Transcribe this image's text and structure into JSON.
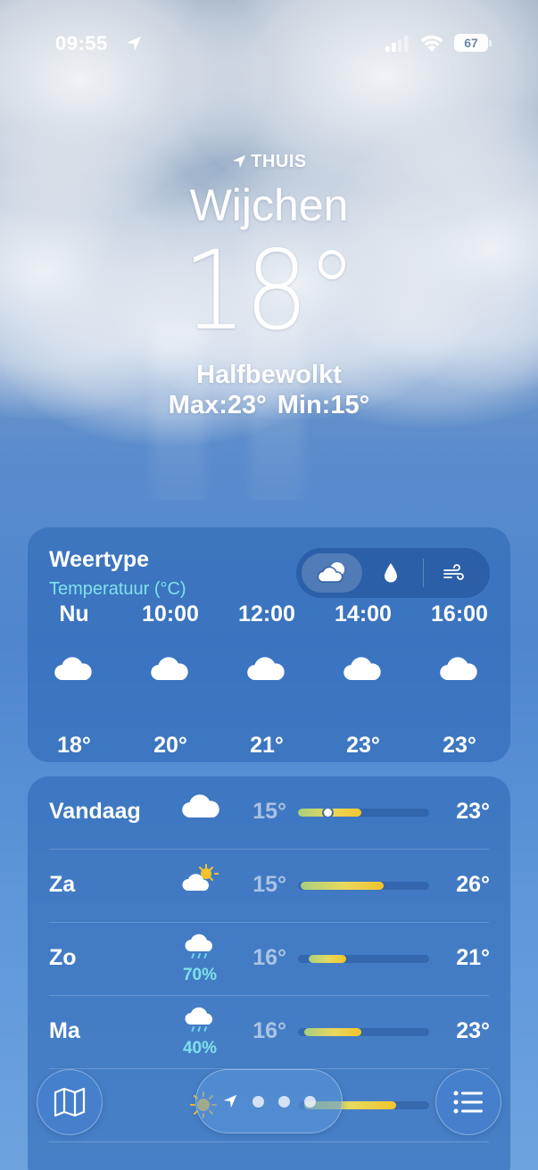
{
  "status_bar": {
    "time": "09:55",
    "battery": "67",
    "icons": [
      "location-arrow-icon",
      "cellular-signal-icon",
      "wifi-icon",
      "battery-icon"
    ]
  },
  "header": {
    "home_label": "THUIS",
    "city": "Wijchen",
    "temperature": "18°",
    "condition": "Halfbewolkt",
    "max": "Max:23°",
    "min": "Min:15°"
  },
  "hourly": {
    "title": "Weertype",
    "subtitle": "Temperatuur (°C)",
    "selected_tab": "cloud-sun-icon",
    "tabs": [
      "cloud-sun-icon",
      "precipitation-drop-icon",
      "wind-icon"
    ],
    "hours": [
      {
        "label": "Nu",
        "temp": "18°",
        "icon": "cloud-icon"
      },
      {
        "label": "10:00",
        "temp": "20°",
        "icon": "cloud-icon"
      },
      {
        "label": "12:00",
        "temp": "21°",
        "icon": "cloud-icon"
      },
      {
        "label": "14:00",
        "temp": "23°",
        "icon": "cloud-icon"
      },
      {
        "label": "16:00",
        "temp": "23°",
        "icon": "cloud-icon"
      }
    ]
  },
  "daily": {
    "days": [
      {
        "name": "Vandaag",
        "icon": "cloud-icon",
        "min": "15°",
        "max": "23°",
        "range_start": 0.0,
        "range_end": 0.48,
        "current": 0.2
      },
      {
        "name": "Za",
        "icon": "sun-behind-cloud-icon",
        "min": "15°",
        "max": "26°",
        "range_start": 0.02,
        "range_end": 0.65
      },
      {
        "name": "Zo",
        "icon": "cloud-rain-icon",
        "precip": "70%",
        "min": "16°",
        "max": "21°",
        "range_start": 0.08,
        "range_end": 0.37
      },
      {
        "name": "Ma",
        "icon": "cloud-rain-icon",
        "precip": "40%",
        "min": "16°",
        "max": "23°",
        "range_start": 0.05,
        "range_end": 0.48
      }
    ],
    "partial_row": {
      "icon": "sun-icon",
      "range_start": 0.05,
      "range_end": 0.75
    }
  },
  "bottom_bar": {
    "map_button": "map-icon",
    "list_button": "list-icon",
    "pages": [
      "location-arrow-icon",
      "page-dot",
      "page-dot",
      "page-dot"
    ]
  },
  "colors": {
    "accent_cyan": "#7fe1ea",
    "bar_gradient": [
      "#a6cf7c",
      "#e7d95f",
      "#f2c52b"
    ],
    "card_bg": "rgba(42,100,178,0.55)"
  }
}
